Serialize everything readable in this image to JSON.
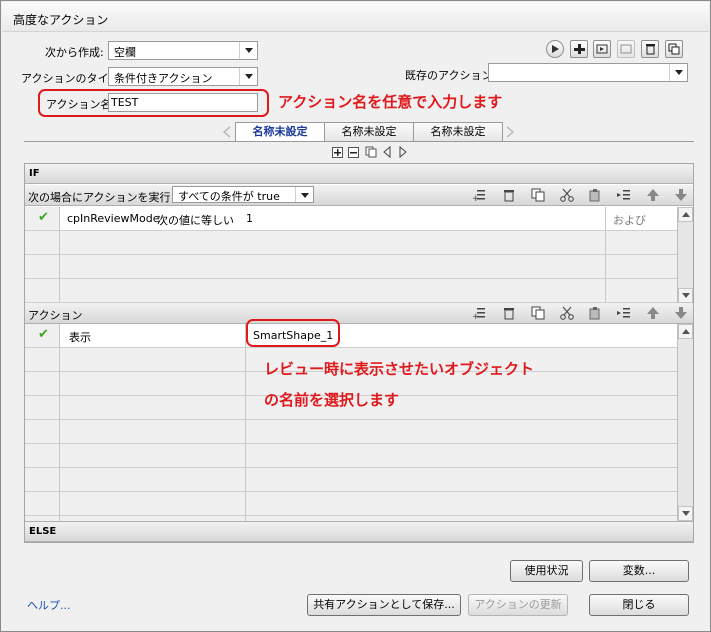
{
  "window": {
    "title": "高度なアクション"
  },
  "form": {
    "create_from_label": "次から作成:",
    "create_from_value": "空欄",
    "action_type_label": "アクションのタイプ:",
    "action_type_value": "条件付きアクション",
    "action_name_label": "アクション名:",
    "action_name_value": "TEST",
    "existing_action_label": "既存のアクション:",
    "existing_action_value": ""
  },
  "annotations": {
    "name_hint": "アクション名を任意で入力します",
    "object_hint_line1": "レビュー時に表示させたいオブジェクト",
    "object_hint_line2": "の名前を選択します"
  },
  "tabs": [
    "名称未設定",
    "名称未設定",
    "名称未設定"
  ],
  "if_section": {
    "header": "IF",
    "condition_label": "次の場合にアクションを実行 ::",
    "condition_value": "すべての条件が true",
    "rows": [
      {
        "check": "✔",
        "variable": "cpInReviewMode",
        "operator": "次の値に等しい",
        "value": "1",
        "logic": "および"
      }
    ]
  },
  "action_section": {
    "header": "アクション",
    "rows": [
      {
        "check": "✔",
        "command": "表示",
        "target": "SmartShape_1"
      }
    ]
  },
  "else_section": {
    "header": "ELSE"
  },
  "buttons": {
    "usage": "使用状況",
    "variables": "変数...",
    "help": "ヘルプ...",
    "save_shared": "共有アクションとして保存...",
    "update_action": "アクションの更新",
    "close": "閉じる"
  },
  "colors": {
    "annotation_red": "#e0191c",
    "check_green": "#3aa61e",
    "tab_active_text": "#1a3a9a"
  }
}
